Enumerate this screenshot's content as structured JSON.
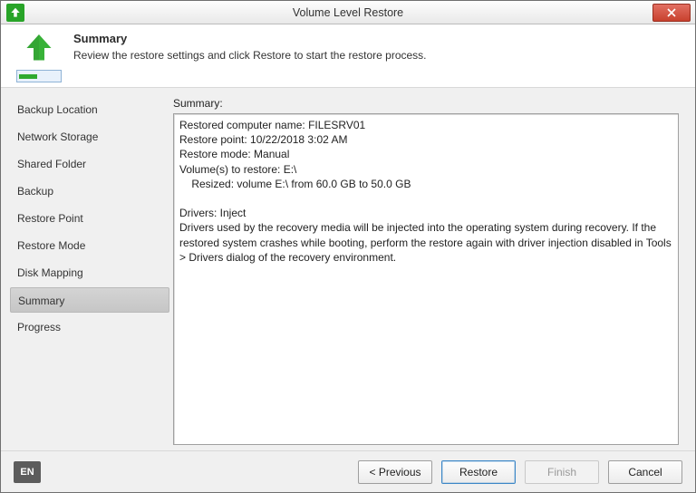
{
  "window": {
    "title": "Volume Level Restore"
  },
  "banner": {
    "title": "Summary",
    "subtitle": "Review the restore settings and click Restore to start the restore process."
  },
  "sidebar": {
    "items": [
      {
        "label": "Backup Location",
        "selected": false
      },
      {
        "label": "Network Storage",
        "selected": false
      },
      {
        "label": "Shared Folder",
        "selected": false
      },
      {
        "label": "Backup",
        "selected": false
      },
      {
        "label": "Restore Point",
        "selected": false
      },
      {
        "label": "Restore Mode",
        "selected": false
      },
      {
        "label": "Disk Mapping",
        "selected": false
      },
      {
        "label": "Summary",
        "selected": true
      },
      {
        "label": "Progress",
        "selected": false
      }
    ]
  },
  "main": {
    "label": "Summary:",
    "text": "Restored computer name: FILESRV01\nRestore point: 10/22/2018 3:02 AM\nRestore mode: Manual\nVolume(s) to restore: E:\\\n    Resized: volume E:\\ from 60.0 GB to 50.0 GB\n\nDrivers: Inject\nDrivers used by the recovery media will be injected into the operating system during recovery. If the restored system crashes while booting, perform the restore again with driver injection disabled in Tools > Drivers dialog of the recovery environment."
  },
  "footer": {
    "language": "EN",
    "previous": "< Previous",
    "restore": "Restore",
    "finish": "Finish",
    "cancel": "Cancel"
  },
  "colors": {
    "accent": "#2faa2f",
    "titlebar_close": "#c8412e"
  }
}
